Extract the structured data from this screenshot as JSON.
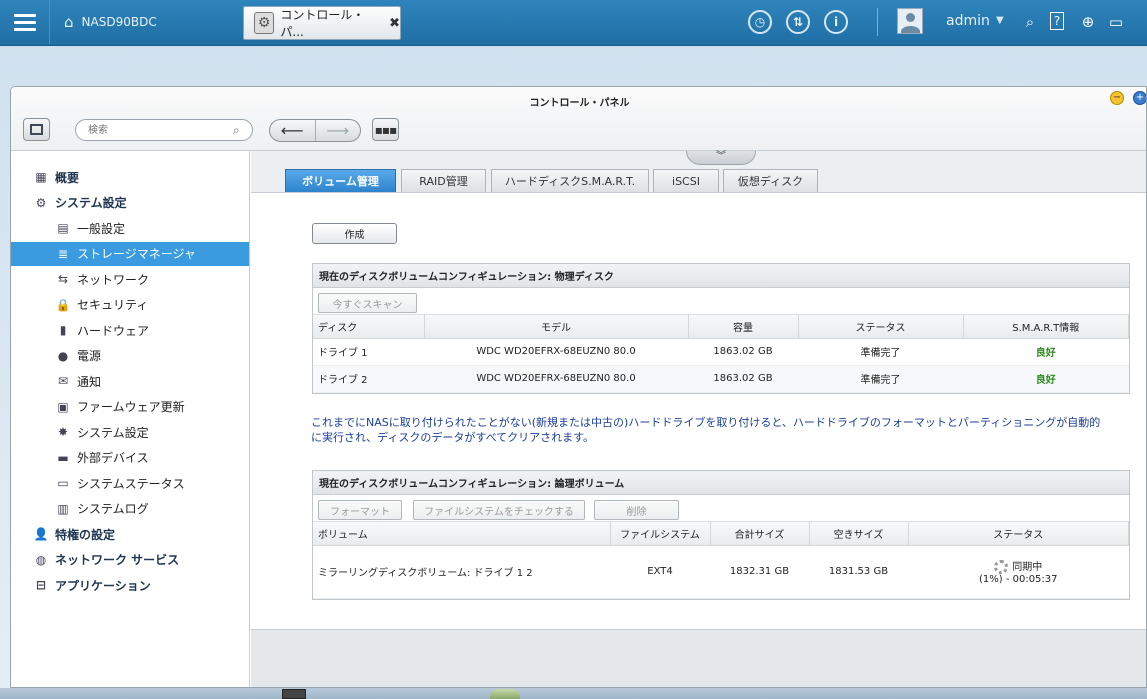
{
  "topbar": {
    "home_label": "NASD90BDC",
    "active_tab_label": "コントロール・パ...",
    "close_glyph": "✖",
    "user": "admin",
    "user_caret": "▼"
  },
  "window": {
    "title": "コントロール・パネル",
    "search_placeholder": "検索"
  },
  "sidebar": {
    "items": [
      {
        "label": "概要",
        "icon": "dashboard-icon",
        "level": "top"
      },
      {
        "label": "システム設定",
        "icon": "gear-icon",
        "level": "top"
      },
      {
        "label": "一般設定",
        "icon": "general-settings-icon",
        "level": "sub"
      },
      {
        "label": "ストレージマネージャ",
        "icon": "storage-icon",
        "level": "sub",
        "active": true
      },
      {
        "label": "ネットワーク",
        "icon": "network-icon",
        "level": "sub"
      },
      {
        "label": "セキュリティ",
        "icon": "lock-icon",
        "level": "sub"
      },
      {
        "label": "ハードウェア",
        "icon": "hardware-icon",
        "level": "sub"
      },
      {
        "label": "電源",
        "icon": "power-icon",
        "level": "sub"
      },
      {
        "label": "通知",
        "icon": "notification-icon",
        "level": "sub"
      },
      {
        "label": "ファームウェア更新",
        "icon": "firmware-icon",
        "level": "sub"
      },
      {
        "label": "システム設定",
        "icon": "system-settings-icon",
        "level": "sub"
      },
      {
        "label": "外部デバイス",
        "icon": "external-device-icon",
        "level": "sub"
      },
      {
        "label": "システムステータス",
        "icon": "monitor-icon",
        "level": "sub"
      },
      {
        "label": "システムログ",
        "icon": "log-icon",
        "level": "sub"
      },
      {
        "label": "特権の設定",
        "icon": "user-icon",
        "level": "top"
      },
      {
        "label": "ネットワーク サービス",
        "icon": "globe-icon",
        "level": "top"
      },
      {
        "label": "アプリケーション",
        "icon": "application-icon",
        "level": "top"
      }
    ]
  },
  "tabs": [
    "ボリューム管理",
    "RAID管理",
    "ハードディスクS.M.A.R.T.",
    "iSCSI",
    "仮想ディスク"
  ],
  "create_label": "作成",
  "physical": {
    "title": "現在のディスクボリュームコンフィギュレーション: 物理ディスク",
    "scan_label": "今すぐスキャン",
    "headers": [
      "ディスク",
      "モデル",
      "容量",
      "ステータス",
      "S.M.A.R.T情報"
    ],
    "rows": [
      [
        "ドライブ 1",
        "WDC WD20EFRX-68EUZN0 80.0",
        "1863.02 GB",
        "準備完了",
        "良好"
      ],
      [
        "ドライブ 2",
        "WDC WD20EFRX-68EUZN0 80.0",
        "1863.02 GB",
        "準備完了",
        "良好"
      ]
    ]
  },
  "notice": "これまでにNASに取り付けられたことがない(新規または中古の)ハードドライブを取り付けると、ハードドライブのフォーマットとパーティショニングが自動的に実行され、ディスクのデータがすべてクリアされます。",
  "logical": {
    "title": "現在のディスクボリュームコンフィギュレーション: 論理ボリューム",
    "buttons": [
      "フォーマット",
      "ファイルシステムをチェックする",
      "削除"
    ],
    "headers": [
      "ボリューム",
      "ファイルシステム",
      "合計サイズ",
      "空きサイズ",
      "ステータス"
    ],
    "row": {
      "volume": "ミラーリングディスクボリューム: ドライブ 1 2",
      "fs": "EXT4",
      "total": "1832.31 GB",
      "free": "1831.53 GB",
      "status_line1": "同期中",
      "status_line2": "(1%) - 00:05:37"
    }
  }
}
